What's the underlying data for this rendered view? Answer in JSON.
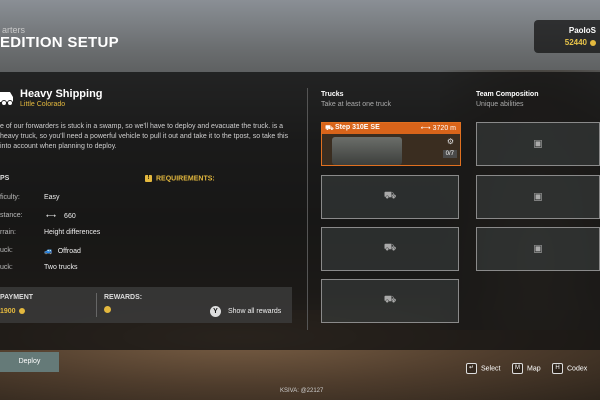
{
  "header": {
    "crumb": "arters",
    "title": "EDITION SETUP"
  },
  "player": {
    "name": "PaoloS",
    "money": "52440"
  },
  "mission": {
    "title": "Heavy Shipping",
    "region": "Little Colorado",
    "description": "e of our forwarders is stuck in a swamp, so we'll have to deploy and evacuate the truck. is a heavy truck, so you'll need a powerful vehicle to pull it out and take it to the tpost, so take this into account when planning to deploy.",
    "section_label": "PS",
    "requirements_label": "REQUIREMENTS:",
    "rows": [
      {
        "label": "ficulty:",
        "value": "Easy"
      },
      {
        "label": "stance:",
        "value": "660"
      },
      {
        "label": "rrain:",
        "value": "Height differences"
      },
      {
        "label": "uck:",
        "value": "Offroad"
      },
      {
        "label": "uck:",
        "value": "Two trucks"
      }
    ]
  },
  "rewards": {
    "payment_label": "PAYMENT",
    "payment_value": "1900",
    "rewards_label": "REWARDS:",
    "show_all_key": "Y",
    "show_all_label": "Show all rewards"
  },
  "trucks": {
    "heading": "Trucks",
    "subheading": "Take at least one truck",
    "selected": {
      "name": "Step 310E SE",
      "distance": "3720 m",
      "count": "0/7"
    }
  },
  "team": {
    "heading": "Team Composition",
    "subheading": "Unique abilities"
  },
  "deploy_label": "Deploy",
  "version": "KSIVA: @22127",
  "hints": [
    {
      "key": "↵",
      "label": "Select"
    },
    {
      "key": "M",
      "label": "Map"
    },
    {
      "key": "H",
      "label": "Codex"
    }
  ],
  "colors": {
    "accent": "#d8641a",
    "gold": "#e3b83e"
  }
}
